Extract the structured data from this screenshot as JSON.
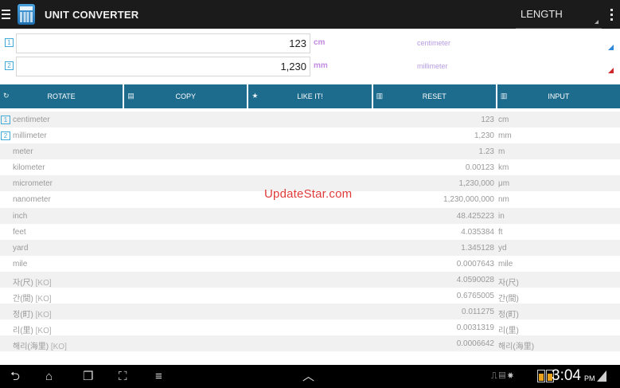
{
  "app": {
    "title": "UNIT CONVERTER",
    "category": "LENGTH"
  },
  "inputs": [
    {
      "index": "1",
      "value": "123",
      "abbr": "cm",
      "name": "centimeter",
      "abbr_color": "#c08be0"
    },
    {
      "index": "2",
      "value": "1,230",
      "abbr": "mm",
      "name": "millimeter",
      "abbr_color": "#c08be0"
    }
  ],
  "toolbar": {
    "rotate": "ROTATE",
    "copy": "COPY",
    "like": "LIKE IT!",
    "reset": "RESET",
    "input": "INPUT"
  },
  "results": [
    {
      "badge": "1",
      "name": "centimeter",
      "ko": "",
      "value": "123",
      "unit": "cm"
    },
    {
      "badge": "2",
      "name": "millimeter",
      "ko": "",
      "value": "1,230",
      "unit": "mm"
    },
    {
      "badge": "",
      "name": "meter",
      "ko": "",
      "value": "1.23",
      "unit": "m"
    },
    {
      "badge": "",
      "name": "kilometer",
      "ko": "",
      "value": "0.00123",
      "unit": "km"
    },
    {
      "badge": "",
      "name": "micrometer",
      "ko": "",
      "value": "1,230,000",
      "unit": "μm"
    },
    {
      "badge": "",
      "name": "nanometer",
      "ko": "",
      "value": "1,230,000,000",
      "unit": "nm"
    },
    {
      "badge": "",
      "name": "inch",
      "ko": "",
      "value": "48.425223",
      "unit": "in"
    },
    {
      "badge": "",
      "name": "feet",
      "ko": "",
      "value": "4.035384",
      "unit": "ft"
    },
    {
      "badge": "",
      "name": "yard",
      "ko": "",
      "value": "1.345128",
      "unit": "yd"
    },
    {
      "badge": "",
      "name": "mile",
      "ko": "",
      "value": "0.0007643",
      "unit": "mile"
    },
    {
      "badge": "",
      "name": "자(尺)",
      "ko": "[KO]",
      "value": "4.0590028",
      "unit": "자(尺)"
    },
    {
      "badge": "",
      "name": "간(間)",
      "ko": "[KO]",
      "value": "0.6765005",
      "unit": "간(間)"
    },
    {
      "badge": "",
      "name": "정(町)",
      "ko": "[KO]",
      "value": "0.011275",
      "unit": "정(町)"
    },
    {
      "badge": "",
      "name": "리(里)",
      "ko": "[KO]",
      "value": "0.0031319",
      "unit": "리(里)"
    },
    {
      "badge": "",
      "name": "해리(海里)",
      "ko": "[KO]",
      "value": "0.0006642",
      "unit": "해리(海里)"
    }
  ],
  "watermark": "UpdateStar.com",
  "system": {
    "time": "3:04",
    "ampm": "PM"
  },
  "colors": {
    "toolbar": "#1d6b8d",
    "accent": "#3fa9d8",
    "unit_purple": "#b69be0"
  }
}
